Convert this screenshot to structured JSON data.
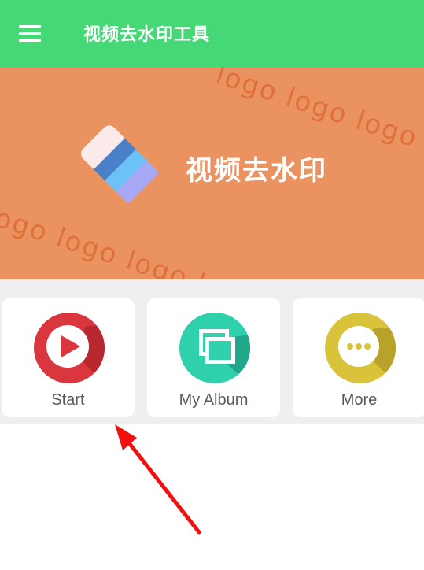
{
  "appbar": {
    "title": "视频去水印工具",
    "background": "#46d876",
    "menu_icon": "menu-icon"
  },
  "banner": {
    "title": "视频去水印",
    "background": "#ea9361",
    "watermark_text_1": "logo logo logo",
    "watermark_text_2": "logo logo logo lo",
    "watermark_color": "#e0703a",
    "logo_icon": "eraser-icon"
  },
  "tiles": [
    {
      "label": "Start",
      "icon": "play-icon",
      "color": "#d9363e"
    },
    {
      "label": "My Album",
      "icon": "photos-icon",
      "color": "#2fd0ac"
    },
    {
      "label": "More",
      "icon": "more-dots-icon",
      "color": "#d8c33a"
    }
  ],
  "annotation": {
    "arrow_color": "#f01010"
  }
}
